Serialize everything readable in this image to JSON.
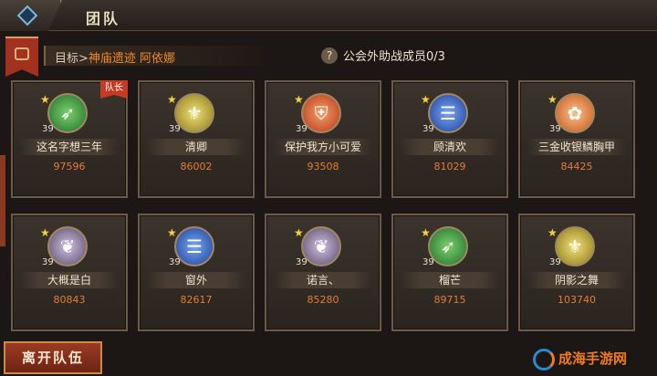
{
  "header": {
    "title": "团队"
  },
  "target": {
    "label": "目标>",
    "value": "神庙遗迹 阿依娜"
  },
  "guild_help": {
    "icon": "?",
    "text": "公会外助战成员0/3"
  },
  "members": [
    {
      "name": "这名字想三年",
      "power": "97596",
      "level": "39",
      "emblem": "green",
      "icon": "bow-icon",
      "leader": "队长"
    },
    {
      "name": "清卿",
      "power": "86002",
      "level": "39",
      "emblem": "gold",
      "icon": "lily-icon"
    },
    {
      "name": "保护我方小可爱",
      "power": "93508",
      "level": "39",
      "emblem": "red",
      "icon": "shield-icon"
    },
    {
      "name": "顾清欢",
      "power": "81029",
      "level": "39",
      "emblem": "blue",
      "icon": "scroll-icon"
    },
    {
      "name": "三金收银鳞胸甲",
      "power": "84425",
      "level": "39",
      "emblem": "orange",
      "icon": "paw-icon"
    },
    {
      "name": "大概是白",
      "power": "80843",
      "level": "39",
      "emblem": "purple",
      "icon": "wing-icon"
    },
    {
      "name": "窗外",
      "power": "82617",
      "level": "39",
      "emblem": "blue",
      "icon": "scroll-icon"
    },
    {
      "name": "诺言、",
      "power": "85280",
      "level": "39",
      "emblem": "purple",
      "icon": "wing-icon"
    },
    {
      "name": "榴芒",
      "power": "89715",
      "level": "39",
      "emblem": "green",
      "icon": "bow-icon"
    },
    {
      "name": "阴影之舞",
      "power": "103740",
      "level": "39",
      "emblem": "gold",
      "icon": "lily-icon"
    }
  ],
  "footer": {
    "leave_label": "离开队伍",
    "watermark": "成海手游网"
  }
}
